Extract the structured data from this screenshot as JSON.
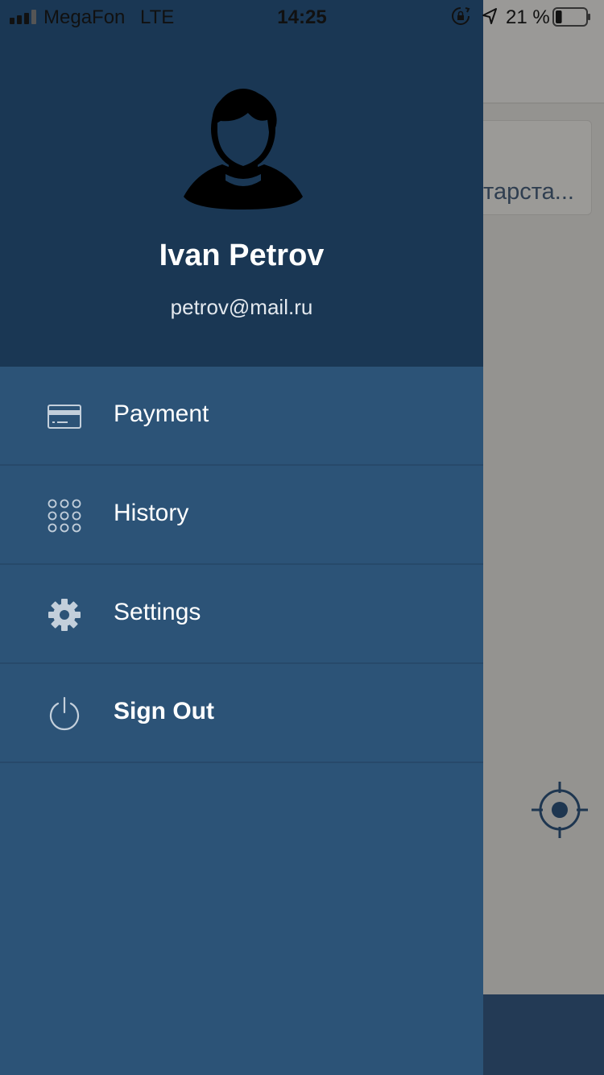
{
  "status_bar": {
    "carrier": "MegaFon",
    "network": "LTE",
    "time": "14:25",
    "battery_percent": "21 %",
    "battery_level": 0.21
  },
  "background": {
    "card_text": "тарста..."
  },
  "drawer": {
    "user": {
      "name": "Ivan Petrov",
      "email": "petrov@mail.ru"
    },
    "menu": [
      {
        "label": "Payment",
        "icon": "credit-card-icon"
      },
      {
        "label": "History",
        "icon": "grid-dots-icon"
      },
      {
        "label": "Settings",
        "icon": "gear-icon"
      },
      {
        "label": "Sign Out",
        "icon": "power-icon"
      }
    ]
  },
  "colors": {
    "header_bg": "#1a3754",
    "drawer_bg": "#2c5377",
    "overlay_bg": "#949390",
    "text_primary": "#ffffff"
  }
}
